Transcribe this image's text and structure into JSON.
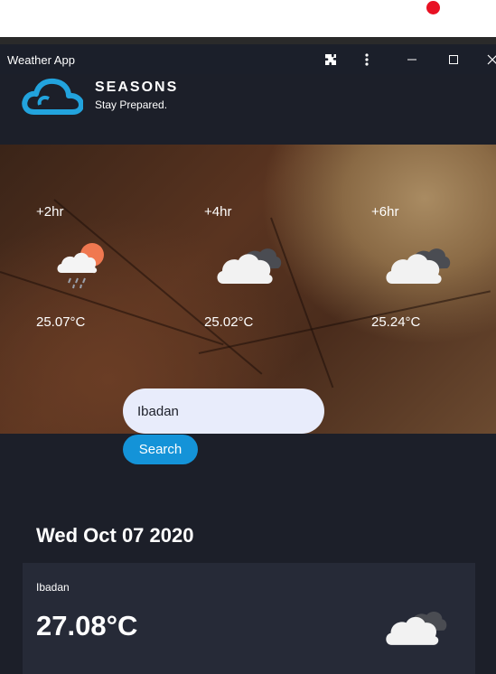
{
  "window": {
    "title": "Weather App"
  },
  "brand": {
    "name": "SEASONS",
    "tagline": "Stay Prepared."
  },
  "forecast": [
    {
      "label": "+2hr",
      "temp": "25.07°C",
      "icon": "rain-sun-icon"
    },
    {
      "label": "+4hr",
      "temp": "25.02°C",
      "icon": "cloud-icon"
    },
    {
      "label": "+6hr",
      "temp": "25.24°C",
      "icon": "cloud-icon"
    }
  ],
  "search": {
    "value": "Ibadan",
    "button_label": "Search"
  },
  "current": {
    "date": "Wed Oct 07 2020",
    "city": "Ibadan",
    "temp": "27.08°C",
    "icon": "cloud-icon"
  },
  "colors": {
    "accent": "#1493d8",
    "background": "#1c1f29",
    "card": "#262a37",
    "input_bg": "#e8ecfb",
    "sun": "#f07850"
  }
}
